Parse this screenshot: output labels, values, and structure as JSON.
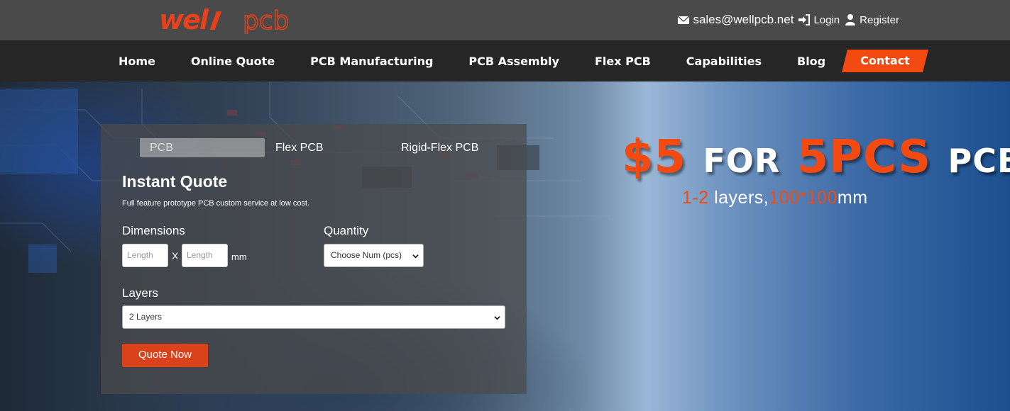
{
  "brand": {
    "logo_text": "wellpcb",
    "accent": "#f24a10"
  },
  "topbar": {
    "email": "sales@wellpcb.net",
    "login": "Login",
    "register": "Register",
    "icons": [
      "envelope-icon",
      "sign-in-icon",
      "user-icon"
    ]
  },
  "nav": {
    "items": [
      "Home",
      "Online Quote",
      "PCB Manufacturing",
      "PCB Assembly",
      "Flex PCB",
      "Capabilities",
      "Blog",
      "Contact"
    ]
  },
  "quote": {
    "tabs": [
      "PCB",
      "Flex PCB",
      "Rigid-Flex PCB"
    ],
    "title": "Instant Quote",
    "subtitle": "Full feature prototype PCB custom service at low cost.",
    "dimensions_label": "Dimensions",
    "length_placeholder": "Length",
    "width_placeholder": "Length",
    "x_sep": "X",
    "unit": "mm",
    "quantity_label": "Quantity",
    "quantity_value": "Choose Num (pcs)",
    "layers_label": "Layers",
    "layers_value": "2 Layers",
    "button": "Quote Now"
  },
  "promo": {
    "price": "$5",
    "for": "FOR",
    "pcs": "5PCS",
    "pcb": "PCB",
    "layers_range": "1-2",
    "layers_word": " layers,",
    "size": "100*100",
    "size_unit": "mm"
  }
}
